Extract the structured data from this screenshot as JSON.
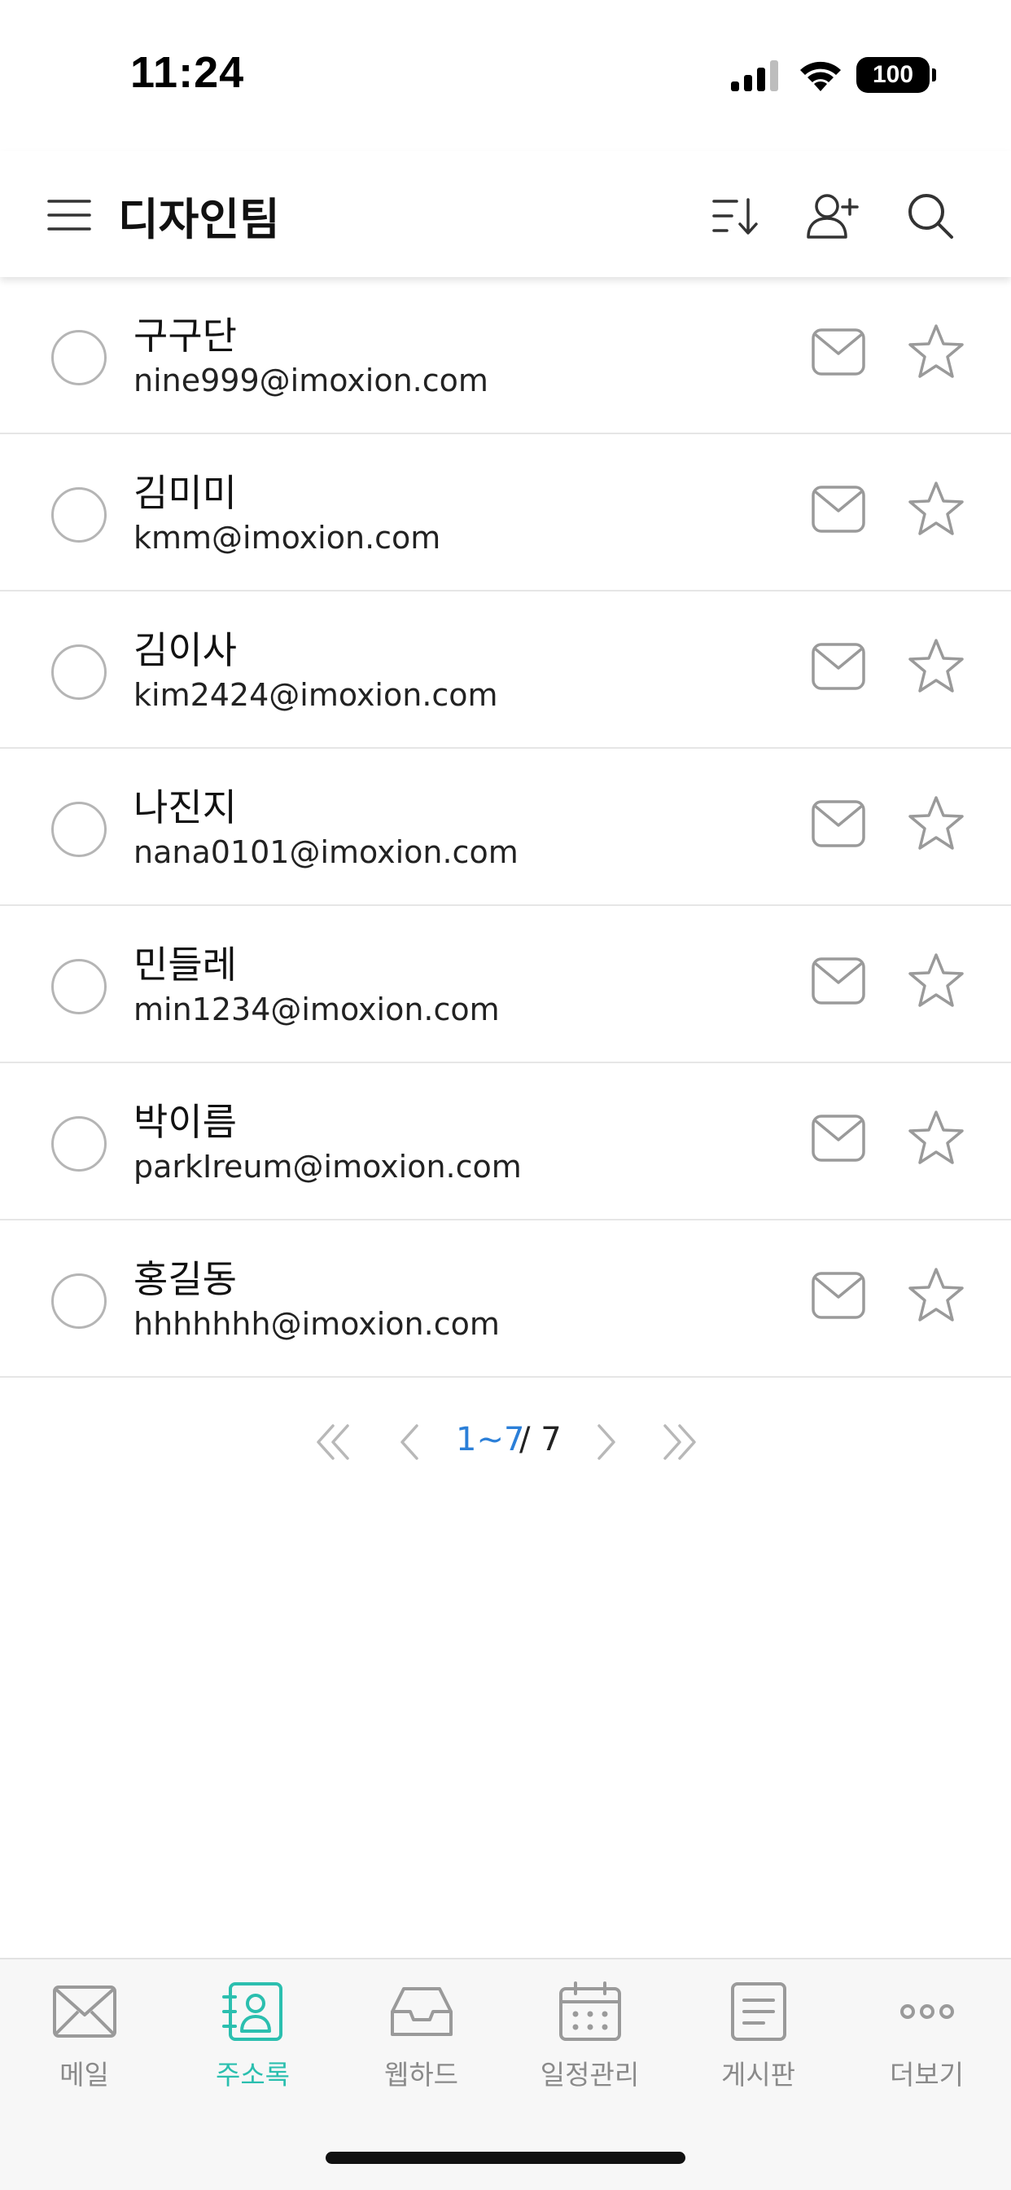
{
  "status_bar": {
    "time": "11:24",
    "battery": "100",
    "icons": [
      "cellular-signal-icon",
      "wifi-icon",
      "battery-icon"
    ]
  },
  "header": {
    "title": "디자인팀",
    "icons": [
      "menu-icon",
      "sort-icon",
      "add-contact-icon",
      "search-icon"
    ]
  },
  "contacts": [
    {
      "name": "구구단",
      "email": "nine999@imoxion.com"
    },
    {
      "name": "김미미",
      "email": "kmm@imoxion.com"
    },
    {
      "name": "김이사",
      "email": "kim2424@imoxion.com"
    },
    {
      "name": "나진지",
      "email": "nana0101@imoxion.com"
    },
    {
      "name": "민들레",
      "email": "min1234@imoxion.com"
    },
    {
      "name": "박이름",
      "email": "parkIreum@imoxion.com"
    },
    {
      "name": "홍길동",
      "email": "hhhhhhh@imoxion.com"
    }
  ],
  "pagination": {
    "current": "1~7",
    "total": "/ 7"
  },
  "tabs": [
    {
      "label": "메일",
      "icon": "mail-icon",
      "active": false
    },
    {
      "label": "주소록",
      "icon": "contacts-icon",
      "active": true
    },
    {
      "label": "웹하드",
      "icon": "inbox-tray-icon",
      "active": false
    },
    {
      "label": "일정관리",
      "icon": "calendar-icon",
      "active": false
    },
    {
      "label": "게시판",
      "icon": "board-icon",
      "active": false
    },
    {
      "label": "더보기",
      "icon": "more-icon",
      "active": false
    }
  ],
  "colors": {
    "accent": "#2bbfaf",
    "page_link": "#2b7fd8",
    "icon_gray": "#9a9a9a",
    "tab_label_gray": "#8a8a8a"
  }
}
